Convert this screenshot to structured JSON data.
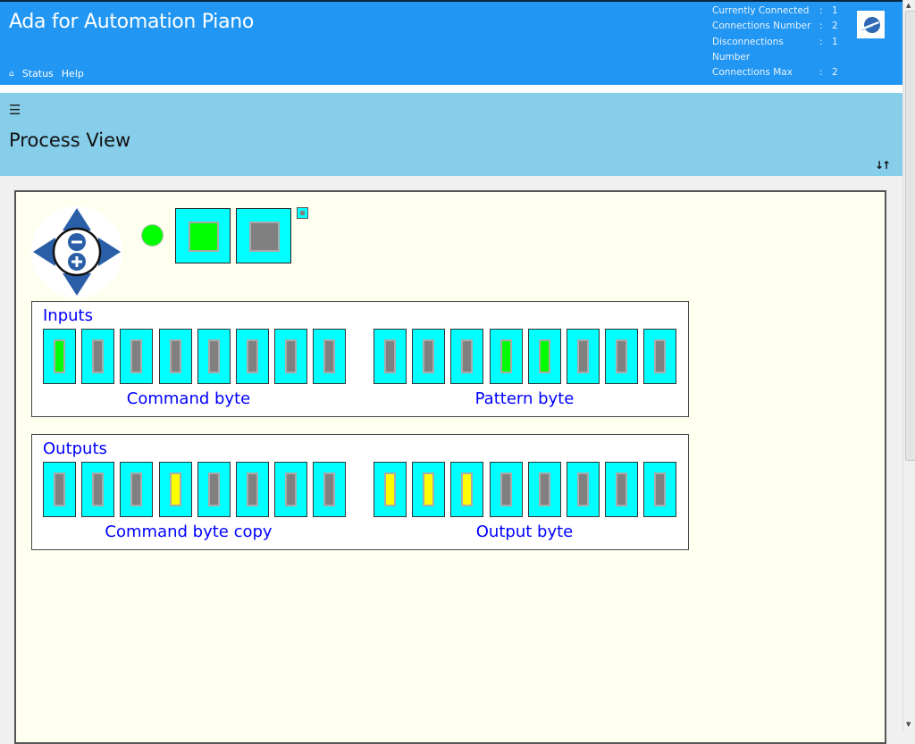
{
  "header": {
    "title": "Ada for Automation Piano",
    "nav": [
      {
        "icon": "home-icon",
        "label": "⌂"
      },
      {
        "label": "Status"
      },
      {
        "label": "Help"
      }
    ],
    "stats": [
      {
        "label": "Currently Connected",
        "value": "1"
      },
      {
        "label": "Connections Number",
        "value": "2"
      },
      {
        "label": "Disconnections Number",
        "value": "1"
      },
      {
        "label": "Connections Max",
        "value": "2"
      }
    ],
    "colon": ":"
  },
  "subheader": {
    "menu_icon": "☰",
    "page_title": "Process View",
    "sort_icon": "↓↑"
  },
  "colors": {
    "header_bg": "#2196f3",
    "subheader_bg": "#87ceeb",
    "canvas_bg": "#fffff0",
    "bit_bg": "#00ffff",
    "off": "#808080",
    "input_on": "#00ff00",
    "output_on": "#ffff00",
    "label": "#0000ff"
  },
  "controls": {
    "led_state": "on",
    "button1_state": "on",
    "button2_state": "off",
    "small_button_state": "off"
  },
  "inputs": {
    "title": "Inputs",
    "bytes": [
      {
        "label": "Command byte",
        "bits": [
          1,
          0,
          0,
          0,
          0,
          0,
          0,
          0
        ]
      },
      {
        "label": "Pattern byte",
        "bits": [
          0,
          0,
          0,
          1,
          1,
          0,
          0,
          0
        ]
      }
    ]
  },
  "outputs": {
    "title": "Outputs",
    "bytes": [
      {
        "label": "Command byte copy",
        "bits": [
          0,
          0,
          0,
          1,
          0,
          0,
          0,
          0
        ]
      },
      {
        "label": "Output byte",
        "bits": [
          1,
          1,
          1,
          0,
          0,
          0,
          0,
          0
        ]
      }
    ]
  }
}
